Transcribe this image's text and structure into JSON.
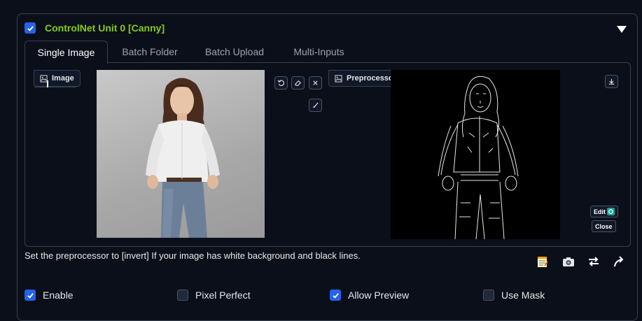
{
  "unit": {
    "title": "ControlNet Unit 0  [Canny]",
    "enabled_header": true,
    "collapse_icon": "triangle-down-icon"
  },
  "tabs": [
    {
      "label": "Single Image",
      "active": true
    },
    {
      "label": "Batch Folder",
      "active": false
    },
    {
      "label": "Batch Upload",
      "active": false
    },
    {
      "label": "Multi-Inputs",
      "active": false
    }
  ],
  "image_panel": {
    "label": "Image",
    "icon": "image-icon",
    "tools": [
      "undo-icon",
      "eraser-icon",
      "close-icon"
    ],
    "extra_tool": "brush-icon"
  },
  "preview_panel": {
    "label": "Preprocessor Preview",
    "icon": "image-icon",
    "download_icon": "download-icon",
    "edit_label": "Edit",
    "close_label": "Close"
  },
  "hint": "Set the preprocessor to [invert] If your image has white background and black lines.",
  "toolbar_icons": [
    "notepad-icon",
    "camera-icon",
    "swap-icon",
    "send-arrow-icon"
  ],
  "options": [
    {
      "label": "Enable",
      "checked": true
    },
    {
      "label": "Pixel Perfect",
      "checked": false
    },
    {
      "label": "Allow Preview",
      "checked": true
    },
    {
      "label": "Use Mask",
      "checked": false
    }
  ],
  "colors": {
    "accent": "#2563eb",
    "title": "#84cc16",
    "background": "#0b0f19",
    "border": "#374151"
  }
}
